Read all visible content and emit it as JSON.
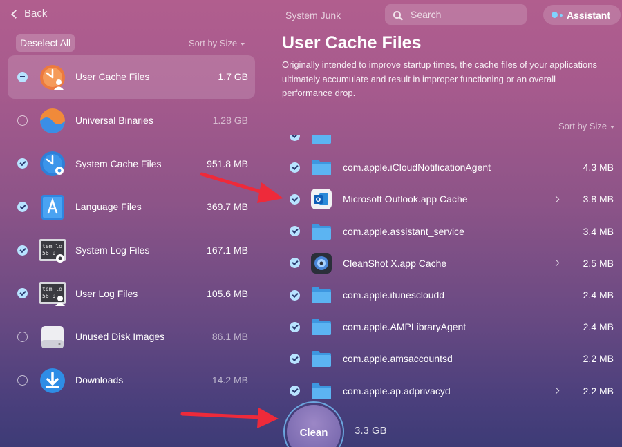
{
  "topbar": {
    "back_label": "Back",
    "section_title": "System Junk",
    "search_placeholder": "Search",
    "assistant_label": "Assistant"
  },
  "left_panel": {
    "deselect_label": "Deselect All",
    "sort_label": "Sort by Size",
    "categories": [
      {
        "name": "User Cache Files",
        "size": "1.7 GB",
        "state": "mixed",
        "icon": "user-cache-icon"
      },
      {
        "name": "Universal Binaries",
        "size": "1.28 GB",
        "state": "off",
        "icon": "universal-binaries-icon"
      },
      {
        "name": "System Cache Files",
        "size": "951.8 MB",
        "state": "on",
        "icon": "system-cache-icon"
      },
      {
        "name": "Language Files",
        "size": "369.7 MB",
        "state": "on",
        "icon": "language-files-icon"
      },
      {
        "name": "System Log Files",
        "size": "167.1 MB",
        "state": "on",
        "icon": "system-log-icon"
      },
      {
        "name": "User Log Files",
        "size": "105.6 MB",
        "state": "on",
        "icon": "user-log-icon"
      },
      {
        "name": "Unused Disk Images",
        "size": "86.1 MB",
        "state": "off",
        "icon": "disk-image-icon"
      },
      {
        "name": "Downloads",
        "size": "14.2 MB",
        "state": "off",
        "icon": "downloads-icon"
      }
    ]
  },
  "detail": {
    "title": "User Cache Files",
    "description": "Originally intended to improve startup times, the cache files of your applications ultimately accumulate and result in improper functioning or an overall performance drop.",
    "sort_label": "Sort by Size",
    "files": [
      {
        "name": "com.apple.iCloudNotificationAgent",
        "size": "4.3 MB",
        "icon": "folder-icon",
        "expandable": false
      },
      {
        "name": "Microsoft Outlook.app Cache",
        "size": "3.8 MB",
        "icon": "outlook-icon",
        "expandable": true
      },
      {
        "name": "com.apple.assistant_service",
        "size": "3.4 MB",
        "icon": "folder-icon",
        "expandable": false
      },
      {
        "name": "CleanShot X.app Cache",
        "size": "2.5 MB",
        "icon": "cleanshot-icon",
        "expandable": true
      },
      {
        "name": "com.apple.itunescloudd",
        "size": "2.4 MB",
        "icon": "folder-icon",
        "expandable": false
      },
      {
        "name": "com.apple.AMPLibraryAgent",
        "size": "2.4 MB",
        "icon": "folder-icon",
        "expandable": false
      },
      {
        "name": "com.apple.amsaccountsd",
        "size": "2.2 MB",
        "icon": "folder-icon",
        "expandable": false
      },
      {
        "name": "com.apple.ap.adprivacyd",
        "size": "2.2 MB",
        "icon": "folder-icon",
        "expandable": true
      }
    ]
  },
  "footer": {
    "clean_label": "Clean",
    "total_size": "3.3 GB"
  },
  "colors": {
    "accent_check": "#b8e3ff",
    "annotation_arrow": "#ee2a3a",
    "folder": "#4aa9ee"
  }
}
